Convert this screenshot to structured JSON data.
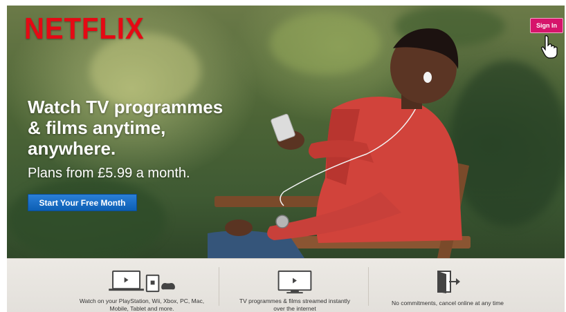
{
  "brand": {
    "logo_text": "NETFLIX"
  },
  "header": {
    "signin_label": "Sign In"
  },
  "hero": {
    "headline_lines": [
      "Watch TV programmes",
      "& films anytime,",
      "anywhere."
    ],
    "plans_text": "Plans from £5.99 a month.",
    "cta_label": "Start Your Free Month"
  },
  "features": [
    {
      "icon": "devices-icon",
      "lines": [
        "Watch on your PlayStation, Wii, Xbox, PC, Mac,",
        "Mobile, Tablet and more."
      ]
    },
    {
      "icon": "tv-icon",
      "lines": [
        "TV programmes & films streamed instantly",
        "over the internet"
      ]
    },
    {
      "icon": "exit-door-icon",
      "lines": [
        "No commitments, cancel online at any time"
      ]
    }
  ],
  "colors": {
    "brand_red": "#e50914",
    "signin_pink": "#d6146b",
    "cta_blue": "#1a6fc7"
  }
}
